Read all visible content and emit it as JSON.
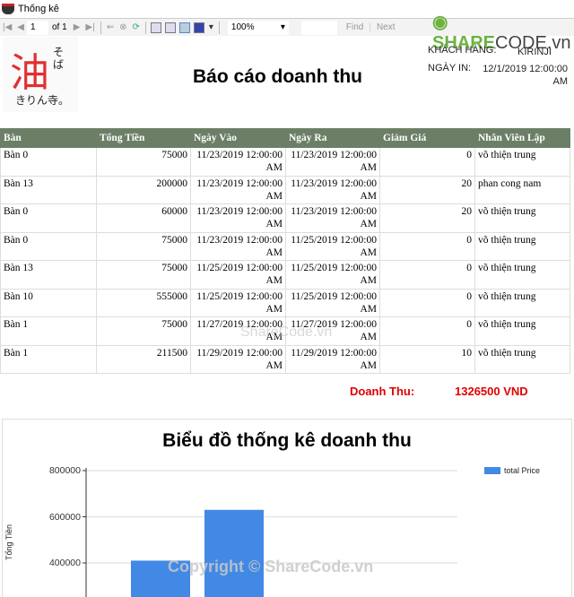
{
  "window": {
    "title": "Thống kê"
  },
  "toolbar": {
    "page": "1",
    "of_label": "of 1",
    "zoom": "100%",
    "find": "Find",
    "next": "Next"
  },
  "watermark": {
    "brand": "SHARE",
    "brand2": "CODE.vn",
    "copyright": "Copyright © ShareCode.vn",
    "center": "ShareCode.vn"
  },
  "logo": {
    "kanji": "油",
    "kana": "そば",
    "kana2": "きりん寺。"
  },
  "report": {
    "title": "Báo cáo doanh thu",
    "customer_label": "KHÁCH HÀNG:",
    "customer_value": "KIRINJI",
    "print_date_label": "NGÀY IN:",
    "print_date_value": "12/1/2019 12:00:00 AM",
    "columns": [
      "Bàn",
      "Tổng Tiền",
      "Ngày Vào",
      "Ngày Ra",
      "Giảm Giá",
      "Nhân Viên Lập"
    ],
    "rows": [
      [
        "Bàn 0",
        "75000",
        "11/23/2019 12:00:00 AM",
        "11/23/2019 12:00:00 AM",
        "0",
        "võ thiện trung"
      ],
      [
        "Bàn 13",
        "200000",
        "11/23/2019 12:00:00 AM",
        "11/23/2019 12:00:00 AM",
        "20",
        "phan cong nam"
      ],
      [
        "Bàn 0",
        "60000",
        "11/23/2019 12:00:00 AM",
        "11/23/2019 12:00:00 AM",
        "20",
        "võ thiện trung"
      ],
      [
        "Bàn 0",
        "75000",
        "11/23/2019 12:00:00 AM",
        "11/25/2019 12:00:00 AM",
        "0",
        "võ thiện trung"
      ],
      [
        "Bàn 13",
        "75000",
        "11/25/2019 12:00:00 AM",
        "11/25/2019 12:00:00 AM",
        "0",
        "võ thiện trung"
      ],
      [
        "Bàn 10",
        "555000",
        "11/25/2019 12:00:00 AM",
        "11/25/2019 12:00:00 AM",
        "0",
        "võ thiện trung"
      ],
      [
        "Bàn 1",
        "75000",
        "11/27/2019 12:00:00 AM",
        "11/27/2019 12:00:00 AM",
        "0",
        "võ thiện trung"
      ],
      [
        "Bàn 1",
        "211500",
        "11/29/2019 12:00:00 AM",
        "11/29/2019 12:00:00 AM",
        "10",
        "võ thiện trung"
      ]
    ],
    "total_label": "Doanh Thu:",
    "total_value": "1326500 VND"
  },
  "chart_data": {
    "type": "bar",
    "title": "Biểu đồ thống kê doanh thu",
    "ylabel": "Tổng Tiền",
    "yticks": [
      "800000",
      "600000",
      "400000"
    ],
    "ylim": [
      0,
      800000
    ],
    "grid": true,
    "legend_position": "top-right",
    "series": [
      {
        "name": "total Price",
        "color": "#4289e6",
        "values": [
          410000,
          630000
        ]
      }
    ]
  }
}
